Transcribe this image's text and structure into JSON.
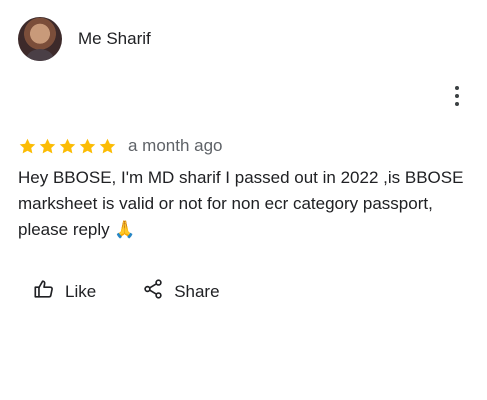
{
  "review": {
    "author_name": "Me Sharif",
    "rating": 5,
    "max_rating": 5,
    "time_ago": "a month ago",
    "text": "Hey BBOSE, I'm MD sharif I passed out in 2022 ,is BBOSE marksheet is valid or not for non ecr category passport, please reply 🙏"
  },
  "actions": {
    "like_label": "Like",
    "share_label": "Share"
  },
  "icons": {
    "more": "more-vert-icon",
    "star": "star-icon",
    "like": "thumb-up-icon",
    "share": "share-icon"
  },
  "colors": {
    "star": "#fbbc04",
    "text": "#202124",
    "secondary_text": "#5f6368"
  }
}
